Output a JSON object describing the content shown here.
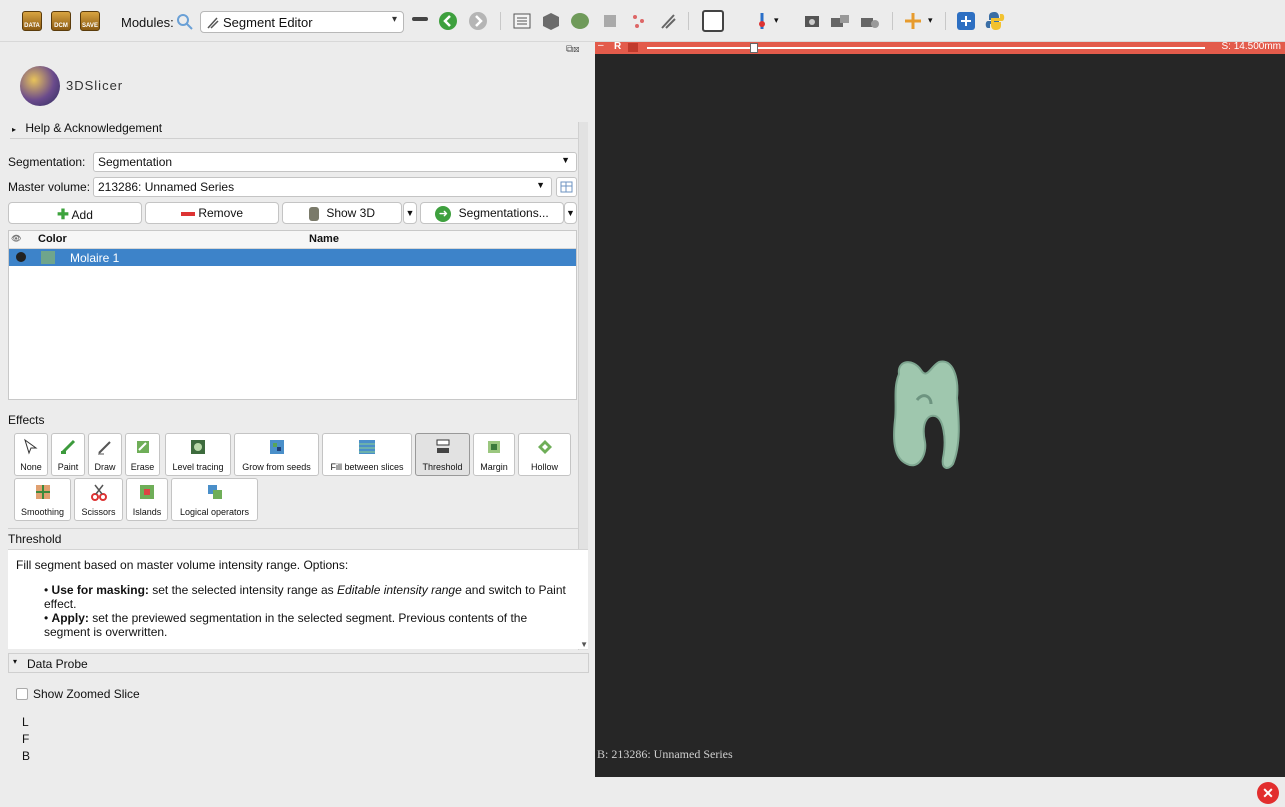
{
  "toolbar": {
    "data_icons": [
      {
        "label": "DATA"
      },
      {
        "label": "DCM"
      },
      {
        "label": "SAVE"
      }
    ],
    "modules_label": "Modules:",
    "module_selected": "Segment Editor"
  },
  "logo": {
    "text": "3DSlicer"
  },
  "help_section": {
    "label": "Help & Acknowledgement"
  },
  "segmentation_row": {
    "label": "Segmentation:",
    "value": "Segmentation"
  },
  "master_volume_row": {
    "label": "Master volume:",
    "value": "213286: Unnamed Series"
  },
  "actions": {
    "add": "Add",
    "remove": "Remove",
    "show3d": "Show 3D",
    "segmentations": "Segmentations..."
  },
  "segment_table": {
    "headers": {
      "color": "Color",
      "name": "Name"
    },
    "rows": [
      {
        "name": "Molaire 1",
        "color": "#6fa58c"
      }
    ]
  },
  "effects": {
    "title": "Effects",
    "items": [
      {
        "label": "None",
        "icon": "arrow-cursor-icon"
      },
      {
        "label": "Paint",
        "icon": "paint-brush-icon"
      },
      {
        "label": "Draw",
        "icon": "pen-icon"
      },
      {
        "label": "Erase",
        "icon": "eraser-icon"
      },
      {
        "label": "Level tracing",
        "icon": "level-tracing-icon"
      },
      {
        "label": "Grow from seeds",
        "icon": "grow-seeds-icon"
      },
      {
        "label": "Fill between slices",
        "icon": "fill-slices-icon"
      },
      {
        "label": "Threshold",
        "icon": "threshold-icon"
      },
      {
        "label": "Margin",
        "icon": "margin-icon"
      },
      {
        "label": "Hollow",
        "icon": "hollow-icon"
      },
      {
        "label": "Smoothing",
        "icon": "smoothing-icon"
      },
      {
        "label": "Scissors",
        "icon": "scissors-icon"
      },
      {
        "label": "Islands",
        "icon": "islands-icon"
      },
      {
        "label": "Logical operators",
        "icon": "logical-operators-icon"
      }
    ]
  },
  "threshold": {
    "title": "Threshold",
    "intro": "Fill segment based on master volume intensity range. Options:",
    "bullet1_bold": "Use for masking:",
    "bullet1_text": " set the selected intensity range as ",
    "bullet1_italic": "Editable intensity range",
    "bullet1_tail": " and switch to Paint effect.",
    "bullet2_bold": "Apply:",
    "bullet2_text": " set the previewed segmentation in the selected segment. Previous contents of the segment is overwritten."
  },
  "data_probe": {
    "title": "Data Probe",
    "show_zoomed_slice": "Show Zoomed Slice",
    "lines": [
      "L",
      "F",
      "B"
    ]
  },
  "viewer": {
    "slice_letter": "R",
    "slice_offset": "S: 14.500mm",
    "background_label": "B: 213286: Unnamed Series"
  },
  "colors": {
    "slice_bar": "#e35b4b",
    "selection": "#3d83c9",
    "tooth": "#9fc7ae"
  }
}
